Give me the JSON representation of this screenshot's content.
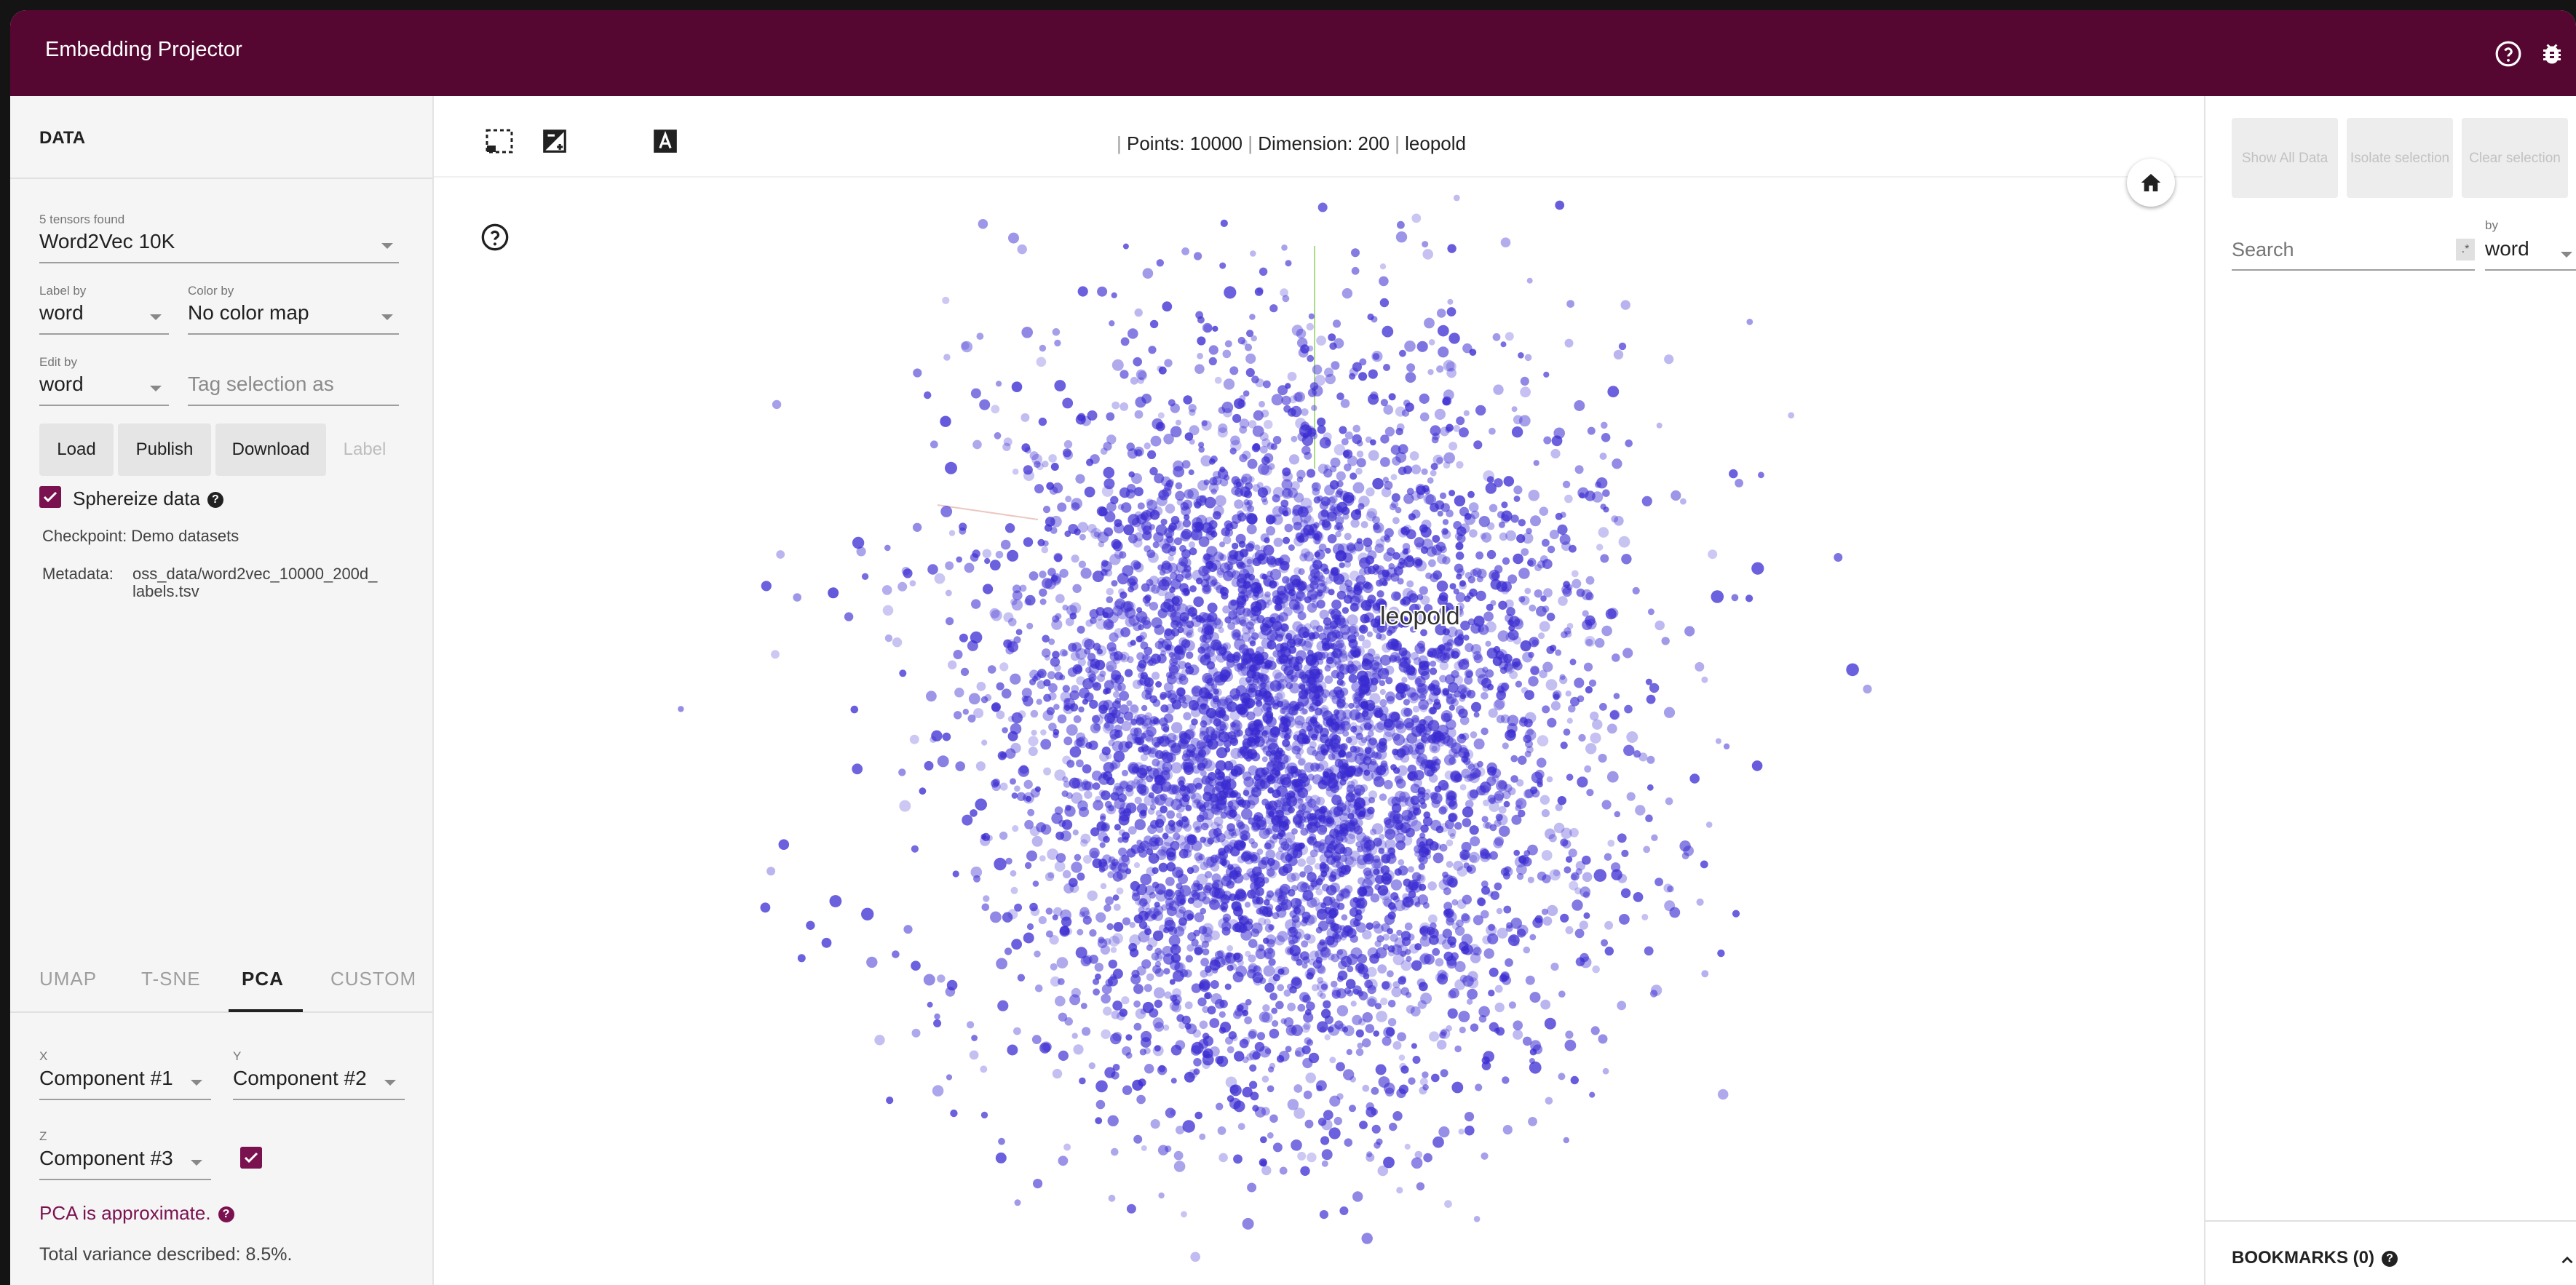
{
  "app": {
    "title": "Embedding Projector",
    "icons": [
      "help-icon",
      "bug-report-icon"
    ],
    "colors": {
      "brand": "#560731",
      "accent": "#7b1250",
      "points": "#3a2bd1"
    }
  },
  "data_panel": {
    "header": "DATA",
    "tensor_count": "5 tensors found",
    "tensor_selected": "Word2Vec 10K",
    "label_by_label": "Label by",
    "label_by_value": "word",
    "color_by_label": "Color by",
    "color_by_value": "No color map",
    "edit_by_label": "Edit by",
    "edit_by_value": "word",
    "tag_placeholder": "Tag selection as",
    "buttons": {
      "load": "Load",
      "publish": "Publish",
      "download": "Download",
      "label": "Label"
    },
    "sphereize_label": "Sphereize data",
    "sphereize_checked": true,
    "checkpoint": "Checkpoint: Demo datasets",
    "metadata_label": "Metadata:",
    "metadata_line1": "oss_data/word2vec_10000_200d_",
    "metadata_line2": "labels.tsv"
  },
  "projection_panel": {
    "tabs": [
      "UMAP",
      "T-SNE",
      "PCA",
      "CUSTOM"
    ],
    "active_tab": "PCA",
    "x_label": "X",
    "x_value": "Component #1",
    "y_label": "Y",
    "y_value": "Component #2",
    "z_label": "Z",
    "z_value": "Component #3",
    "z_enabled": true,
    "approx_text": "PCA is approximate.",
    "variance_text": "Total variance described: 8.5%."
  },
  "toolbar": {
    "icons": [
      "selection-box-icon",
      "night-mode-icon",
      "moon-icon",
      "label-toggle-icon"
    ],
    "points_text": "Points: 10000",
    "dimension_text": "Dimension: 200",
    "selected_word": "leopold",
    "sep": "|"
  },
  "plot": {
    "highlight_label": "leopold",
    "point_count": 10000,
    "point_color": "#3a2bd1"
  },
  "inspector": {
    "show_all": "Show All Data",
    "isolate": "Isolate selection",
    "clear": "Clear selection",
    "search_placeholder": "Search",
    "by_label": "by",
    "by_value": "word",
    "regex_mark": ".*",
    "bookmarks": "BOOKMARKS (0)"
  }
}
